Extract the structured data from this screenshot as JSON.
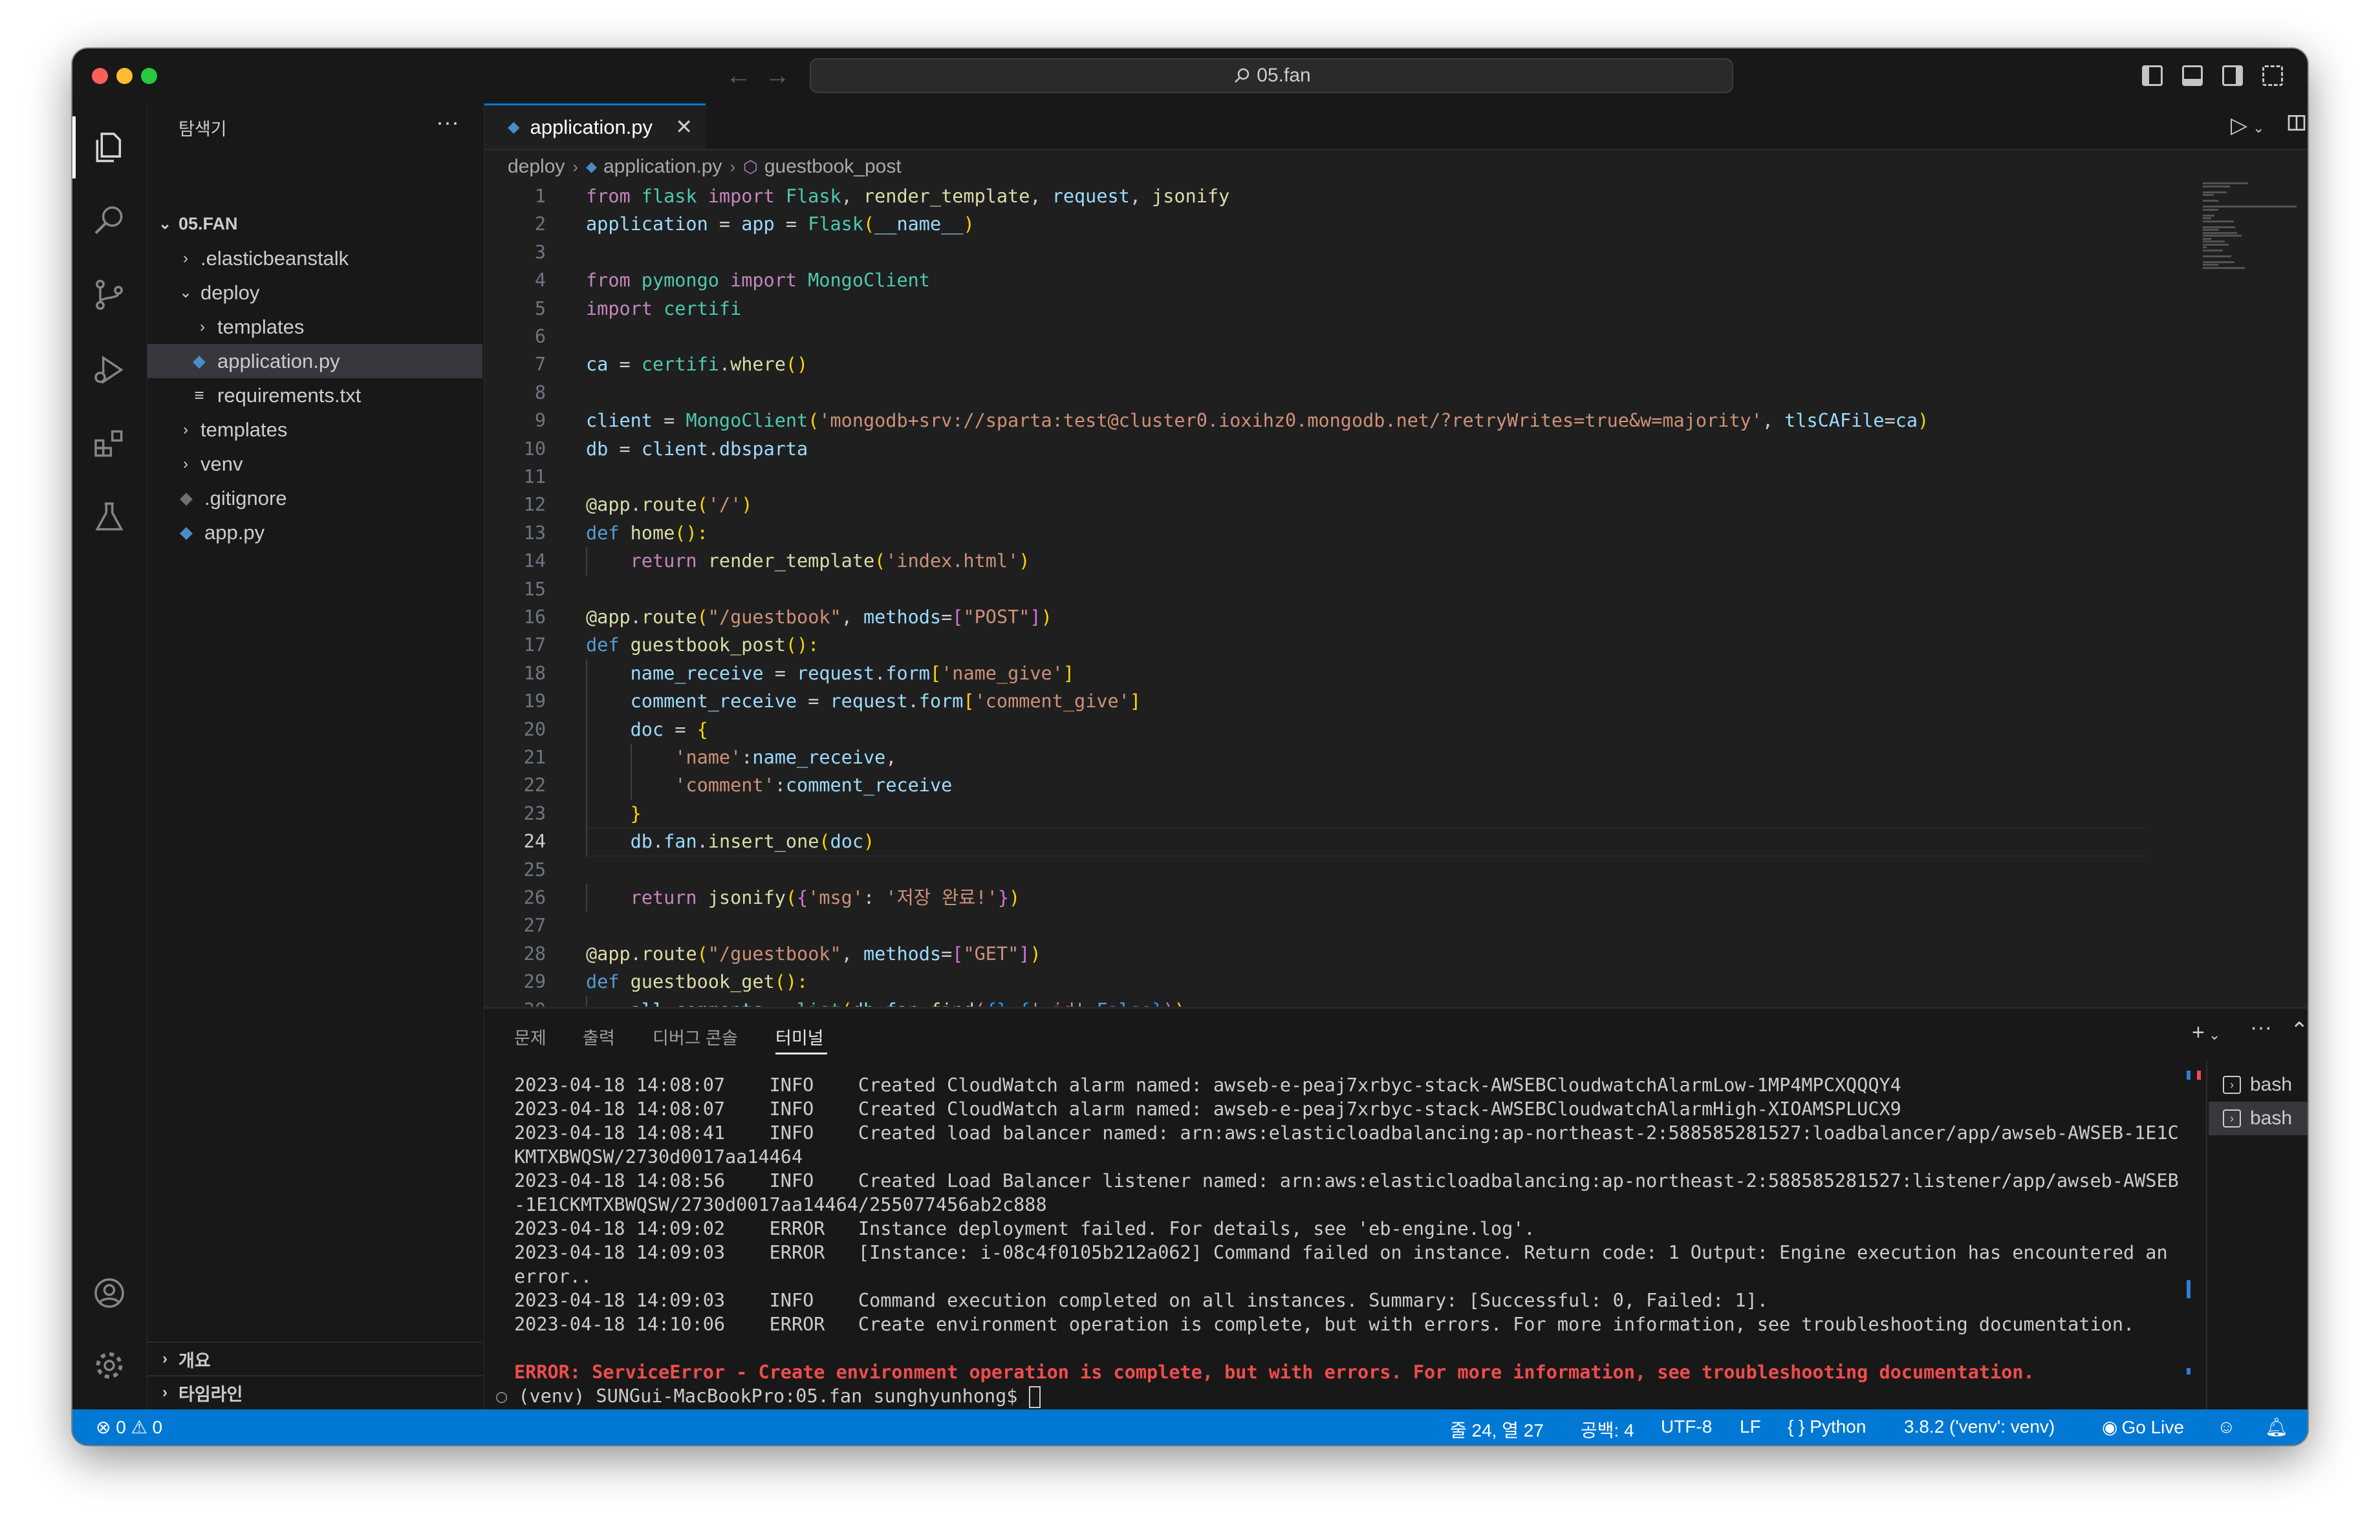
{
  "window": {
    "title": "05.fan"
  },
  "sidebar": {
    "title": "탐색기",
    "more": "···",
    "root": "05.FAN",
    "tree": [
      {
        "label": ".elasticbeanstalk",
        "chevron": "›",
        "icon": ""
      },
      {
        "label": "deploy",
        "chevron": "⌄",
        "icon": ""
      },
      {
        "label": "templates",
        "chevron": "›",
        "icon": ""
      },
      {
        "label": "application.py",
        "chevron": "",
        "icon": "python-icon"
      },
      {
        "label": "requirements.txt",
        "chevron": "",
        "icon": "text-file-icon"
      },
      {
        "label": "templates",
        "chevron": "›",
        "icon": ""
      },
      {
        "label": "venv",
        "chevron": "›",
        "icon": ""
      },
      {
        "label": ".gitignore",
        "chevron": "",
        "icon": "gitignore-icon"
      },
      {
        "label": "app.py",
        "chevron": "",
        "icon": "python-icon"
      }
    ],
    "bottom": [
      {
        "label": "개요"
      },
      {
        "label": "타임라인"
      }
    ]
  },
  "editor": {
    "tab_label": "application.py",
    "close_glyph": "✕",
    "breadcrumb": [
      "deploy",
      "application.py",
      "guestbook_post"
    ],
    "current_line": 24,
    "lines": [
      [
        [
          "from ",
          "kw"
        ],
        [
          "flask ",
          "cls"
        ],
        [
          "import ",
          "kw"
        ],
        [
          "Flask",
          "cls"
        ],
        [
          ", ",
          ""
        ],
        [
          "render_template",
          "fn"
        ],
        [
          ", ",
          ""
        ],
        [
          "request",
          "var"
        ],
        [
          ", ",
          ""
        ],
        [
          "jsonify",
          "fn"
        ]
      ],
      [
        [
          "application ",
          "var"
        ],
        [
          "= ",
          ""
        ],
        [
          "app ",
          "var"
        ],
        [
          "= ",
          ""
        ],
        [
          "Flask",
          "cls"
        ],
        [
          "(",
          "br1"
        ],
        [
          "__name__",
          "var"
        ],
        [
          ")",
          "br1"
        ]
      ],
      [],
      [
        [
          "from ",
          "kw"
        ],
        [
          "pymongo ",
          "cls"
        ],
        [
          "import ",
          "kw"
        ],
        [
          "MongoClient",
          "cls"
        ]
      ],
      [
        [
          "import ",
          "kw"
        ],
        [
          "certifi",
          "cls"
        ]
      ],
      [],
      [
        [
          "ca ",
          "var"
        ],
        [
          "= ",
          ""
        ],
        [
          "certifi",
          "cls"
        ],
        [
          ".",
          ""
        ],
        [
          "where",
          "fn"
        ],
        [
          "()",
          "br1"
        ]
      ],
      [],
      [
        [
          "client ",
          "var"
        ],
        [
          "= ",
          ""
        ],
        [
          "MongoClient",
          "cls"
        ],
        [
          "(",
          "br1"
        ],
        [
          "'mongodb+srv://sparta:test@cluster0.ioxihz0.mongodb.net/?retryWrites=true&w=majority'",
          "str"
        ],
        [
          ", ",
          ""
        ],
        [
          "tlsCAFile",
          "var"
        ],
        [
          "=",
          ""
        ],
        [
          "ca",
          "var"
        ],
        [
          ")",
          "br1"
        ]
      ],
      [
        [
          "db ",
          "var"
        ],
        [
          "= ",
          ""
        ],
        [
          "client",
          "var"
        ],
        [
          ".",
          ""
        ],
        [
          "dbsparta",
          "var"
        ]
      ],
      [],
      [
        [
          "@app",
          "fn"
        ],
        [
          ".",
          ""
        ],
        [
          "route",
          "fn"
        ],
        [
          "(",
          "br1"
        ],
        [
          "'/'",
          "str"
        ],
        [
          ")",
          "br1"
        ]
      ],
      [
        [
          "def ",
          "kwb"
        ],
        [
          "home",
          "fn"
        ],
        [
          "():",
          "br1"
        ]
      ],
      [
        [
          "    ",
          ""
        ],
        [
          "return ",
          "kw"
        ],
        [
          "render_template",
          "fn"
        ],
        [
          "(",
          "br1"
        ],
        [
          "'index.html'",
          "str"
        ],
        [
          ")",
          "br1"
        ]
      ],
      [],
      [
        [
          "@app",
          "fn"
        ],
        [
          ".",
          ""
        ],
        [
          "route",
          "fn"
        ],
        [
          "(",
          "br1"
        ],
        [
          "\"/guestbook\"",
          "str"
        ],
        [
          ", ",
          ""
        ],
        [
          "methods",
          "var"
        ],
        [
          "=",
          ""
        ],
        [
          "[",
          "br2"
        ],
        [
          "\"POST\"",
          "str"
        ],
        [
          "]",
          "br2"
        ],
        [
          ")",
          "br1"
        ]
      ],
      [
        [
          "def ",
          "kwb"
        ],
        [
          "guestbook_post",
          "fn"
        ],
        [
          "():",
          "br1"
        ]
      ],
      [
        [
          "    ",
          ""
        ],
        [
          "name_receive ",
          "var"
        ],
        [
          "= ",
          ""
        ],
        [
          "request",
          "var"
        ],
        [
          ".",
          ""
        ],
        [
          "form",
          "var"
        ],
        [
          "[",
          "br1"
        ],
        [
          "'name_give'",
          "str"
        ],
        [
          "]",
          "br1"
        ]
      ],
      [
        [
          "    ",
          ""
        ],
        [
          "comment_receive ",
          "var"
        ],
        [
          "= ",
          ""
        ],
        [
          "request",
          "var"
        ],
        [
          ".",
          ""
        ],
        [
          "form",
          "var"
        ],
        [
          "[",
          "br1"
        ],
        [
          "'comment_give'",
          "str"
        ],
        [
          "]",
          "br1"
        ]
      ],
      [
        [
          "    ",
          ""
        ],
        [
          "doc ",
          "var"
        ],
        [
          "= ",
          ""
        ],
        [
          "{",
          "br1"
        ]
      ],
      [
        [
          "        ",
          ""
        ],
        [
          "'name'",
          "str"
        ],
        [
          ":",
          ""
        ],
        [
          "name_receive",
          "var"
        ],
        [
          ",",
          ""
        ]
      ],
      [
        [
          "        ",
          ""
        ],
        [
          "'comment'",
          "str"
        ],
        [
          ":",
          ""
        ],
        [
          "comment_receive",
          "var"
        ]
      ],
      [
        [
          "    ",
          ""
        ],
        [
          "}",
          "br1"
        ]
      ],
      [
        [
          "    ",
          ""
        ],
        [
          "db",
          "var"
        ],
        [
          ".",
          ""
        ],
        [
          "fan",
          "var"
        ],
        [
          ".",
          ""
        ],
        [
          "insert_one",
          "fn"
        ],
        [
          "(",
          "br1"
        ],
        [
          "doc",
          "var"
        ],
        [
          ")",
          "br1"
        ]
      ],
      [],
      [
        [
          "    ",
          ""
        ],
        [
          "return ",
          "kw"
        ],
        [
          "jsonify",
          "fn"
        ],
        [
          "(",
          "br1"
        ],
        [
          "{",
          "br2"
        ],
        [
          "'msg'",
          "str"
        ],
        [
          ": ",
          ""
        ],
        [
          "'저장 완료!'",
          "str"
        ],
        [
          "}",
          "br2"
        ],
        [
          ")",
          "br1"
        ]
      ],
      [],
      [
        [
          "@app",
          "fn"
        ],
        [
          ".",
          ""
        ],
        [
          "route",
          "fn"
        ],
        [
          "(",
          "br1"
        ],
        [
          "\"/guestbook\"",
          "str"
        ],
        [
          ", ",
          ""
        ],
        [
          "methods",
          "var"
        ],
        [
          "=",
          ""
        ],
        [
          "[",
          "br2"
        ],
        [
          "\"GET\"",
          "str"
        ],
        [
          "]",
          "br2"
        ],
        [
          ")",
          "br1"
        ]
      ],
      [
        [
          "def ",
          "kwb"
        ],
        [
          "guestbook_get",
          "fn"
        ],
        [
          "():",
          "br1"
        ]
      ],
      [
        [
          "    ",
          ""
        ],
        [
          "all_comments ",
          "var"
        ],
        [
          "= ",
          ""
        ],
        [
          "list",
          "cls"
        ],
        [
          "(",
          "br1"
        ],
        [
          "db",
          "var"
        ],
        [
          ".",
          ""
        ],
        [
          "fan",
          "var"
        ],
        [
          ".",
          ""
        ],
        [
          "find",
          "fn"
        ],
        [
          "(",
          "br2"
        ],
        [
          "{}",
          "br3"
        ],
        [
          ",",
          ""
        ],
        [
          "{",
          "br3"
        ],
        [
          "'_id'",
          "str"
        ],
        [
          ":",
          ""
        ],
        [
          "False",
          "kwb"
        ],
        [
          "}",
          "br3"
        ],
        [
          ")",
          "br2"
        ],
        [
          ")",
          "br1"
        ]
      ]
    ]
  },
  "panel": {
    "tabs": [
      "문제",
      "출력",
      "디버그 콘솔",
      "터미널"
    ],
    "active_tab": 3,
    "terminal_lines": [
      {
        "text": "2023-04-18 14:08:07    INFO    Created CloudWatch alarm named: awseb-e-peaj7xrbyc-stack-AWSEBCloudwatchAlarmLow-1MP4MPCXQQQY4",
        "kind": "normal"
      },
      {
        "text": "2023-04-18 14:08:07    INFO    Created CloudWatch alarm named: awseb-e-peaj7xrbyc-stack-AWSEBCloudwatchAlarmHigh-XIOAMSPLUCX9",
        "kind": "normal"
      },
      {
        "text": "2023-04-18 14:08:41    INFO    Created load balancer named: arn:aws:elasticloadbalancing:ap-northeast-2:588585281527:loadbalancer/app/awseb-AWSEB-1E1C",
        "kind": "normal"
      },
      {
        "text": "KMTXBWQSW/2730d0017aa14464",
        "kind": "normal"
      },
      {
        "text": "2023-04-18 14:08:56    INFO    Created Load Balancer listener named: arn:aws:elasticloadbalancing:ap-northeast-2:588585281527:listener/app/awseb-AWSEB",
        "kind": "normal"
      },
      {
        "text": "-1E1CKMTXBWQSW/2730d0017aa14464/255077456ab2c888",
        "kind": "normal"
      },
      {
        "text": "2023-04-18 14:09:02    ERROR   Instance deployment failed. For details, see 'eb-engine.log'.",
        "kind": "normal"
      },
      {
        "text": "2023-04-18 14:09:03    ERROR   [Instance: i-08c4f0105b212a062] Command failed on instance. Return code: 1 Output: Engine execution has encountered an",
        "kind": "normal"
      },
      {
        "text": "error..",
        "kind": "normal"
      },
      {
        "text": "2023-04-18 14:09:03    INFO    Command execution completed on all instances. Summary: [Successful: 0, Failed: 1].",
        "kind": "normal"
      },
      {
        "text": "2023-04-18 14:10:06    ERROR   Create environment operation is complete, but with errors. For more information, see troubleshooting documentation.",
        "kind": "normal"
      },
      {
        "text": "",
        "kind": "normal"
      },
      {
        "text": "ERROR: ServiceError - Create environment operation is complete, but with errors. For more information, see troubleshooting documentation.",
        "kind": "error"
      },
      {
        "text": "(venv) SUNGui-MacBookPro:05.fan sunghyunhong$ ",
        "kind": "prompt"
      }
    ],
    "terminals": [
      "bash",
      "bash"
    ]
  },
  "statusbar": {
    "problems": "⊗ 0 ⚠ 0",
    "position": "줄 24, 열 27",
    "spaces": "공백: 4",
    "encoding": "UTF-8",
    "eol": "LF",
    "language": "{ } Python",
    "interpreter": "3.8.2 ('venv': venv)",
    "golive": "Go Live"
  },
  "colors": {
    "accent": "#0078d4",
    "editor_bg": "#1f1f1f",
    "chrome_bg": "#181818",
    "error": "#f14c4c"
  }
}
